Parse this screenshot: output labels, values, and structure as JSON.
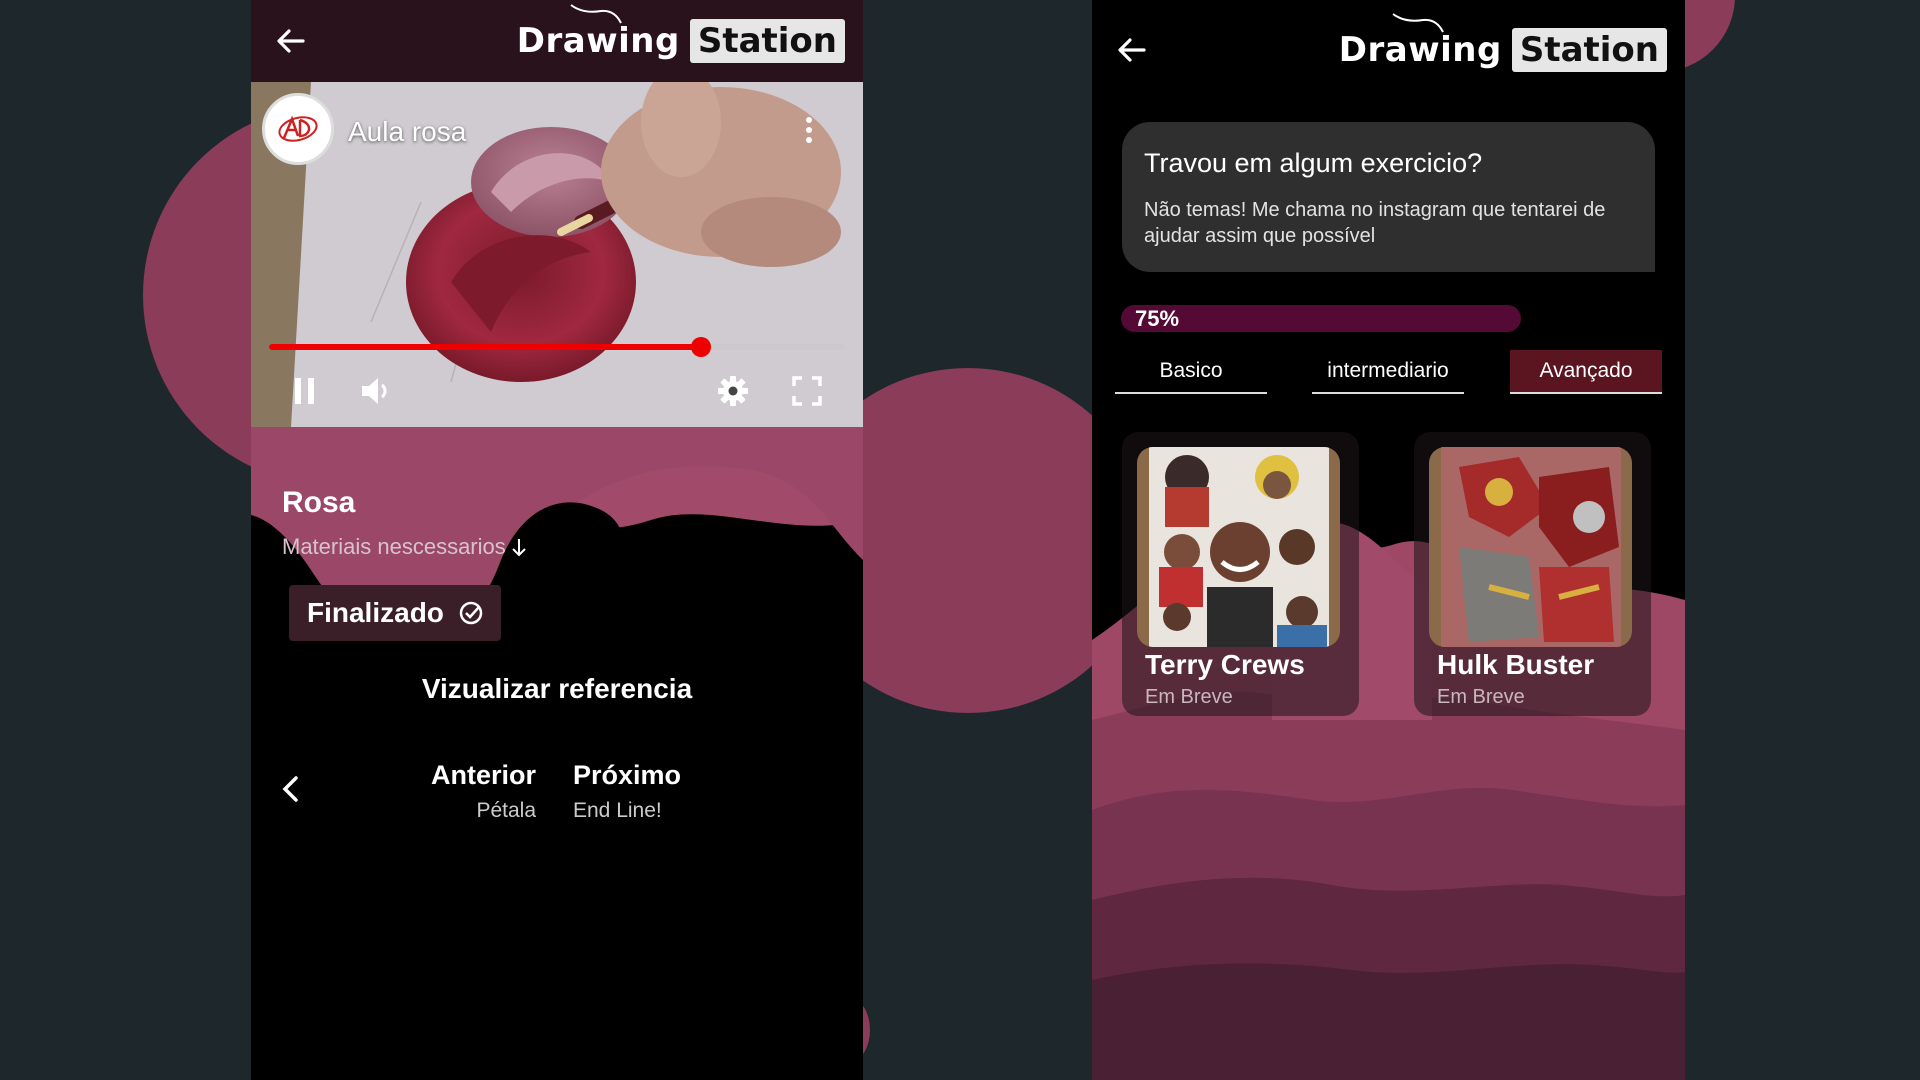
{
  "colors": {
    "background": "#1d272c",
    "accent_pink": "#8a3c58",
    "video_progress": "#e00000",
    "course_progress": "#540a34",
    "active_tab": "#5a1521"
  },
  "lesson_screen": {
    "header": {
      "back_icon": "arrow-left-icon",
      "logo_word1": "Drawing",
      "logo_word2": "Station"
    },
    "video": {
      "channel_avatar": "AD",
      "title": "Aula rosa",
      "progress": 0.75,
      "controls": [
        "pause-icon",
        "volume-icon",
        "settings-gear-icon",
        "fullscreen-icon"
      ]
    },
    "lesson_title": "Rosa",
    "materials_label": "Materiais nescessarios",
    "status_label": "Finalizado",
    "reference_link": "Vizualizar referencia",
    "nav": {
      "prev_label": "Anterior",
      "prev_sub": "Pétala",
      "next_label": "Próximo",
      "next_sub": "End Line!"
    }
  },
  "levels_screen": {
    "header": {
      "back_icon": "arrow-left-icon",
      "logo_word1": "Drawing",
      "logo_word2": "Station"
    },
    "help": {
      "title": "Travou em algum exercicio?",
      "body": "Não temas! Me chama no instagram que tentarei de ajudar assim que possível"
    },
    "progress_value": 0.75,
    "progress_label": "75%",
    "tabs": [
      {
        "label": "Basico",
        "active": false
      },
      {
        "label": "intermediario",
        "active": false
      },
      {
        "label": "Avançado",
        "active": true
      }
    ],
    "cards": [
      {
        "title": "Terry Crews",
        "subtitle": "Em Breve"
      },
      {
        "title": "Hulk Buster",
        "subtitle": "Em Breve"
      }
    ]
  }
}
